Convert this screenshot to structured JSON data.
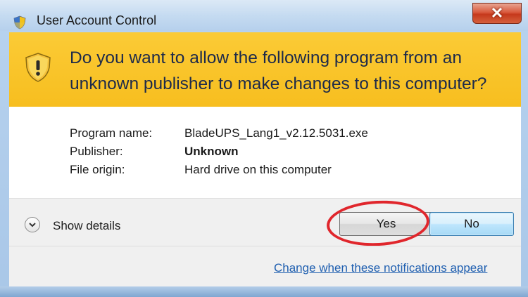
{
  "window": {
    "title": "User Account Control",
    "close_icon": "close-icon"
  },
  "banner": {
    "message": "Do you want to allow the following program from an unknown publisher to make changes to this computer?",
    "color": "#fcc528"
  },
  "details": {
    "rows": [
      {
        "label": "Program name:",
        "value": "BladeUPS_Lang1_v2.12.5031.exe"
      },
      {
        "label": "Publisher:",
        "value": "Unknown"
      },
      {
        "label": "File origin:",
        "value": "Hard drive on this computer"
      }
    ]
  },
  "footer": {
    "show_details": "Show details",
    "yes_label": "Yes",
    "no_label": "No",
    "link": "Change when these notifications appear",
    "annotation_color": "#e0262c"
  }
}
